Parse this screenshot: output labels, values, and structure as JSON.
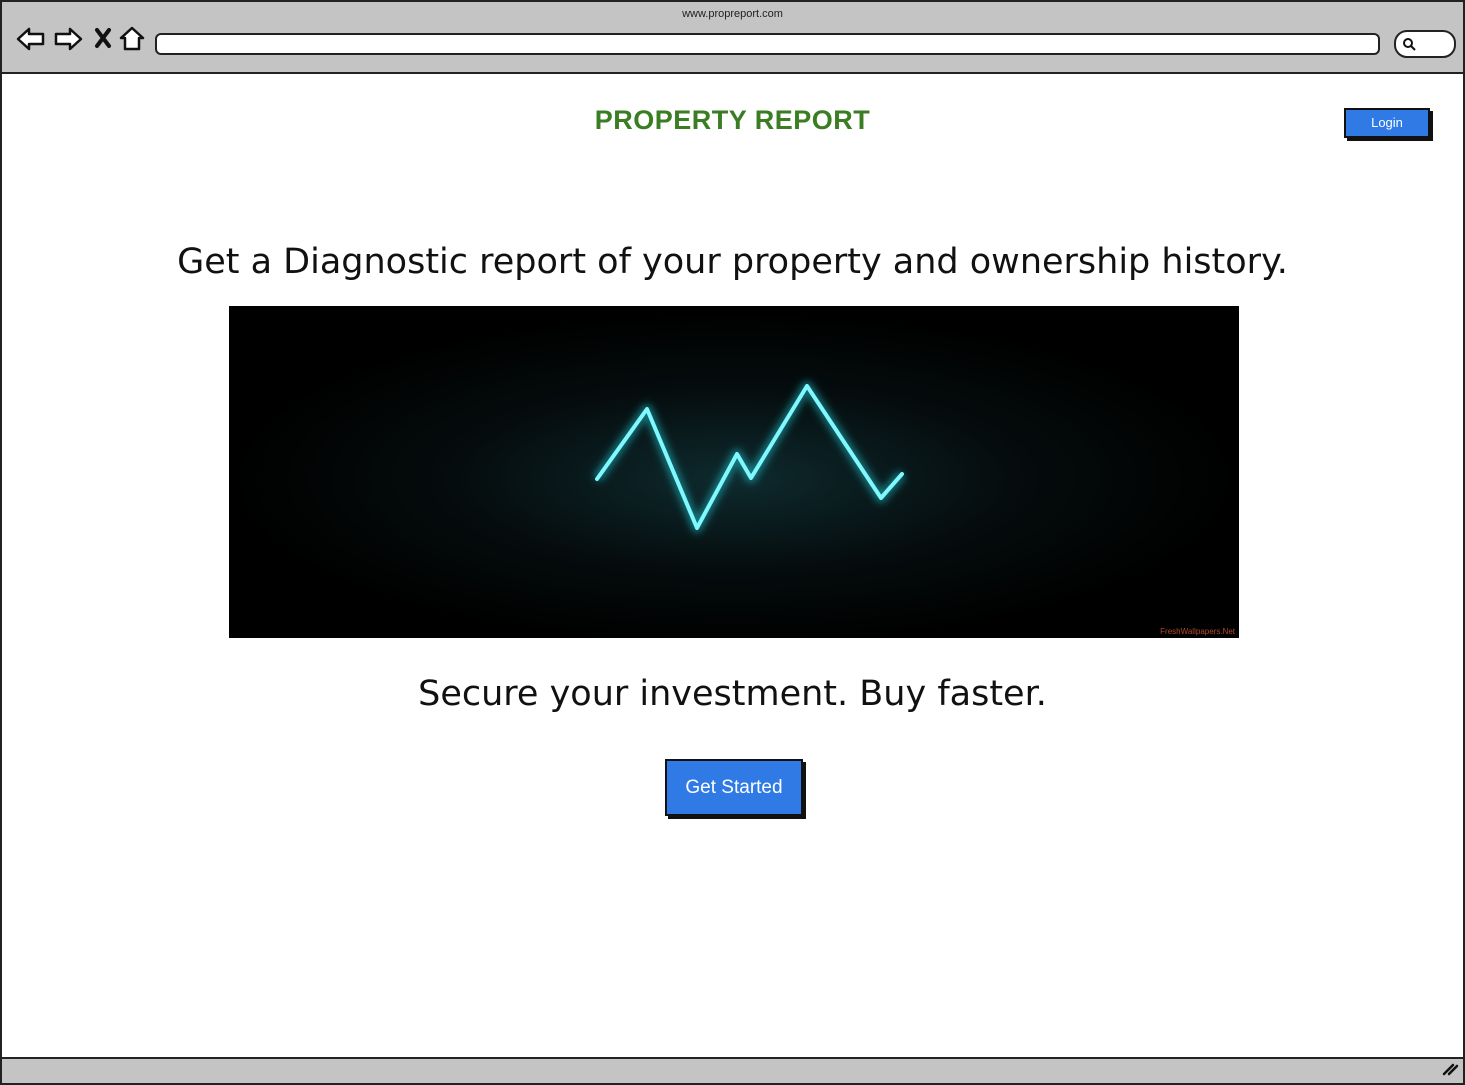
{
  "browser": {
    "url": "www.propreport.com",
    "icons": [
      "back-arrow-icon",
      "forward-arrow-icon",
      "close-icon",
      "home-icon",
      "search-icon",
      "resize-grip-icon"
    ]
  },
  "header": {
    "brand": "PROPERTY REPORT",
    "login_label": "Login"
  },
  "main": {
    "headline": "Get a Diagnostic report of your property and ownership history.",
    "hero_watermark": "FreshWallpapers.Net",
    "tagline": "Secure your investment. Buy faster.",
    "cta_label": "Get Started"
  },
  "colors": {
    "brand": "#3a7d23",
    "button": "#2f7ae5",
    "pulse": "#22e4f0",
    "chrome": "#c4c4c4"
  }
}
